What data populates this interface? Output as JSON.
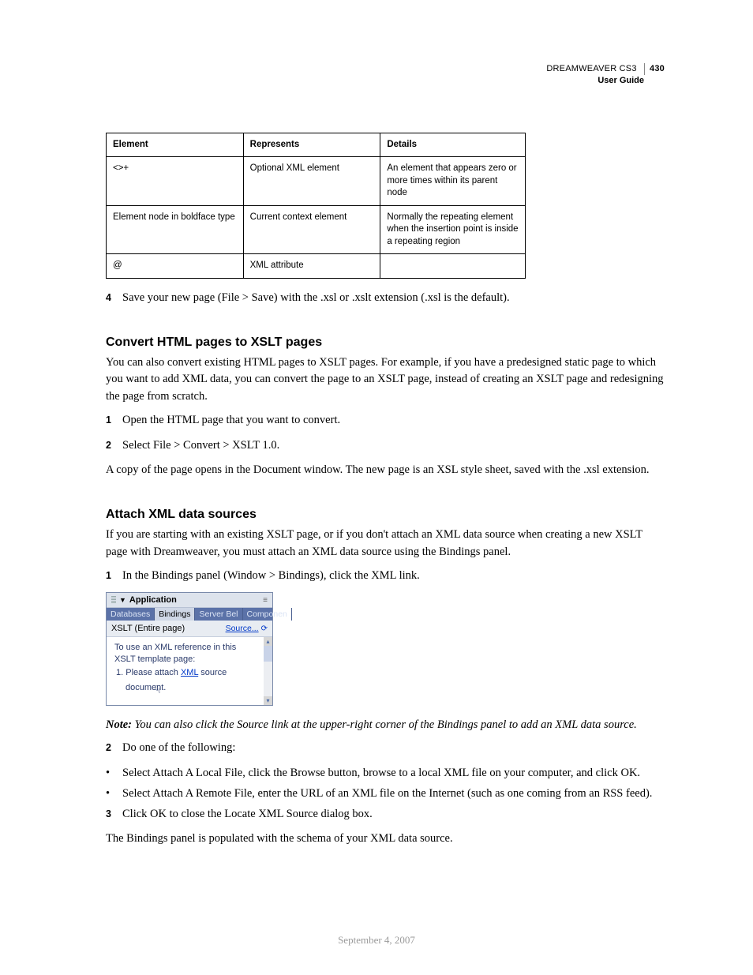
{
  "header": {
    "product": "DREAMWEAVER CS3",
    "guide": "User Guide",
    "page_num": "430"
  },
  "table": {
    "headers": [
      "Element",
      "Represents",
      "Details"
    ],
    "rows": [
      [
        "<>+",
        "Optional XML element",
        "An element that appears zero or more times within its parent node"
      ],
      [
        "Element node in boldface type",
        "Current context element",
        "Normally the repeating element when the insertion point is inside a repeating region"
      ],
      [
        "@",
        "XML attribute",
        ""
      ]
    ]
  },
  "step4": {
    "num": "4",
    "text": "Save your new page (File > Save) with the .xsl or .xslt extension (.xsl is the default)."
  },
  "section1": {
    "heading": "Convert HTML pages to XSLT pages",
    "intro": "You can also convert existing HTML pages to XSLT pages. For example, if you have a predesigned static page to which you want to add XML data, you can convert the page to an XSLT page, instead of creating an XSLT page and redesigning the page from scratch.",
    "steps": [
      {
        "num": "1",
        "text": "Open the HTML page that you want to convert."
      },
      {
        "num": "2",
        "text": "Select File > Convert > XSLT 1.0."
      }
    ],
    "outro": "A copy of the page opens in the Document window. The new page is an XSL style sheet, saved with the .xsl extension."
  },
  "section2": {
    "heading": "Attach XML data sources",
    "intro": "If you are starting with an existing XSLT page, or if you don't attach an XML data source when creating a new XSLT page with Dreamweaver, you must attach an XML data source using the Bindings panel.",
    "step1": {
      "num": "1",
      "text": "In the Bindings panel (Window > Bindings), click the XML link."
    },
    "note_label": "Note:",
    "note_text": " You can also click the Source link at the upper-right corner of the Bindings panel to add an XML data source.",
    "step2": {
      "num": "2",
      "text": "Do one of the following:"
    },
    "bullets": [
      "Select Attach A Local File, click the Browse button, browse to a local XML file on your computer, and click OK.",
      "Select Attach A Remote File, enter the URL of an XML file on the Internet (such as one coming from an RSS feed)."
    ],
    "step3": {
      "num": "3",
      "text": "Click OK to close the Locate XML Source dialog box."
    },
    "outro": "The Bindings panel is populated with the schema of your XML data source."
  },
  "panel": {
    "title": "Application",
    "tabs": [
      "Databases",
      "Bindings",
      "Server Bel",
      "Componen"
    ],
    "active_tab": 1,
    "subtitle": "XSLT (Entire page)",
    "source_link": "Source...",
    "body_line1": "To use an XML reference in this XSLT template page:",
    "body_item_prefix": "1.  Please attach ",
    "body_item_link": "XML",
    "body_item_suffix": " source document."
  },
  "footer": "September 4, 2007"
}
